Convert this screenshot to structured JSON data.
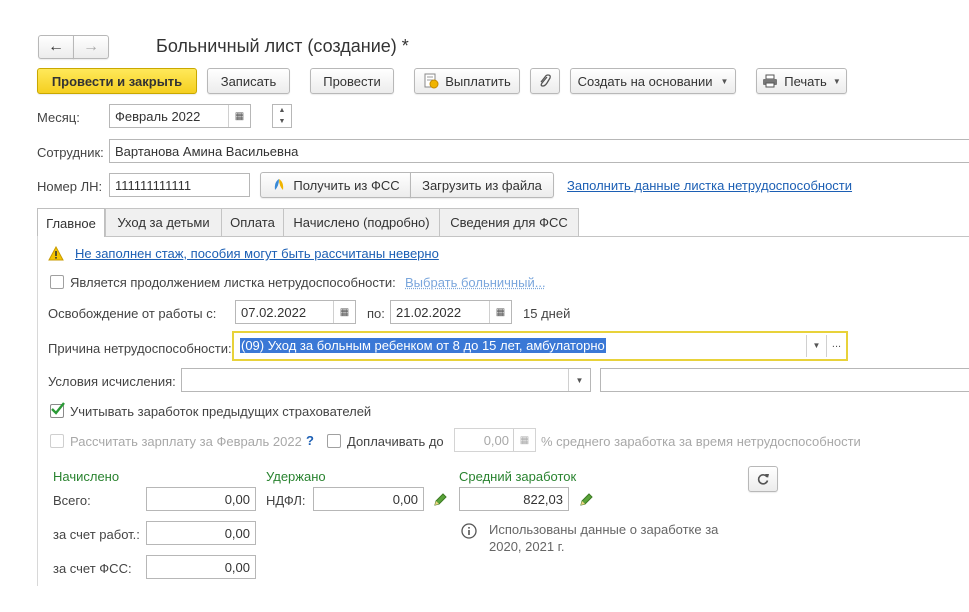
{
  "window": {
    "title": "Больничный лист (создание) *",
    "nav_back": "←",
    "nav_forward": "→"
  },
  "toolbar": {
    "post_close": "Провести и закрыть",
    "save": "Записать",
    "post": "Провести",
    "pay": "Выплатить",
    "create_based": "Создать на основании",
    "print": "Печать"
  },
  "header": {
    "month_label": "Месяц:",
    "month_value": "Февраль 2022",
    "employee_label": "Сотрудник:",
    "employee_value": "Вартанова Амина Васильевна",
    "ln_label": "Номер ЛН:",
    "ln_value": "111111111111",
    "get_fss": "Получить из ФСС",
    "load_file": "Загрузить из файла",
    "fill_link": "Заполнить данные листка нетрудоспособности"
  },
  "tabs": [
    {
      "label": "Главное",
      "active": true
    },
    {
      "label": "Уход за детьми",
      "active": false
    },
    {
      "label": "Оплата",
      "active": false
    },
    {
      "label": "Начислено (подробно)",
      "active": false
    },
    {
      "label": "Сведения для ФСС",
      "active": false
    }
  ],
  "main": {
    "warning": "Не заполнен стаж, пособия могут быть рассчитаны неверно",
    "continuation_label": "Является продолжением листка нетрудоспособности:",
    "continuation_link": "Выбрать больничный...",
    "release_label": "Освобождение от работы с:",
    "date_from": "07.02.2022",
    "to_label": "по:",
    "date_to": "21.02.2022",
    "days": "15 дней",
    "reason_label": "Причина нетрудоспособности:",
    "reason_value": "(09) Уход за больным ребенком от 8 до 15 лет, амбулаторно",
    "conditions_label": "Условия исчисления:",
    "conditions_value": "",
    "conditions_extra": "",
    "consider_prev_label": "Учитывать заработок предыдущих страхователей",
    "consider_prev_checked": true,
    "calc_salary_label": "Рассчитать зарплату за Февраль 2022",
    "help": "?",
    "topup_label": "Доплачивать до",
    "topup_value": "0,00",
    "topup_suffix": "% среднего заработка за время нетрудоспособности"
  },
  "totals": {
    "accrued_title": "Начислено",
    "total_label": "Всего:",
    "total_value": "0,00",
    "employer_label": "за счет работ.:",
    "employer_value": "0,00",
    "fss_label": "за счет ФСС:",
    "fss_value": "0,00",
    "withheld_title": "Удержано",
    "ndfl_label": "НДФЛ:",
    "ndfl_value": "0,00",
    "avg_title": "Средний заработок",
    "avg_value": "822,03",
    "info_text_1": "Использованы данные о заработке за",
    "info_text_2": "2020,  2021 г."
  },
  "colors": {
    "primary_button": "#f5cf20",
    "green_heading": "#29832f",
    "link": "#1c5fb4",
    "focus_border": "#e8d23a",
    "selection": "#3a78d6"
  }
}
